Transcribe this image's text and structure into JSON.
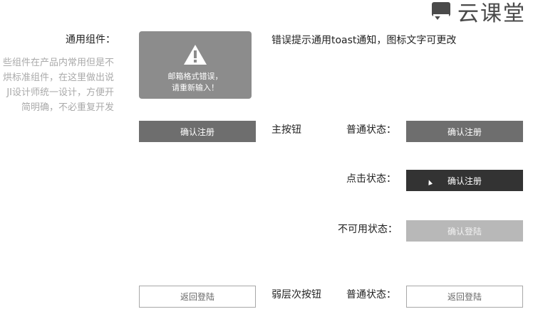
{
  "logo": {
    "text": "云课堂"
  },
  "section": {
    "title": "通用组件：",
    "desc": [
      "些组件在产品内常用但是不",
      "烘标准组件，在这里做出说",
      "JI设计师统一设计，方便开",
      "简明确，不必重复开发"
    ]
  },
  "toast": {
    "line1": "邮箱格式错误，",
    "line2": "请重新输入！"
  },
  "note": "错误提示通用toast通知，图标文字可更改",
  "primary": {
    "demo_label": "确认注册",
    "name": "主按钮",
    "normal_state": "普通状态：",
    "normal_label": "确认注册",
    "pressed_state": "点击状态：",
    "pressed_label": "确认注册",
    "disabled_state": "不可用状态：",
    "disabled_label": "确认登陆"
  },
  "secondary": {
    "demo_label": "返回登陆",
    "name": "弱层次按钮",
    "normal_state": "普通状态：",
    "normal_label": "返回登陆"
  },
  "colors": {
    "toast_bg": "#8c8c8c",
    "primary": "#6e6e6e",
    "pressed": "#333333",
    "disabled": "#b8b8b8",
    "outline_border": "#a8a8a8"
  }
}
